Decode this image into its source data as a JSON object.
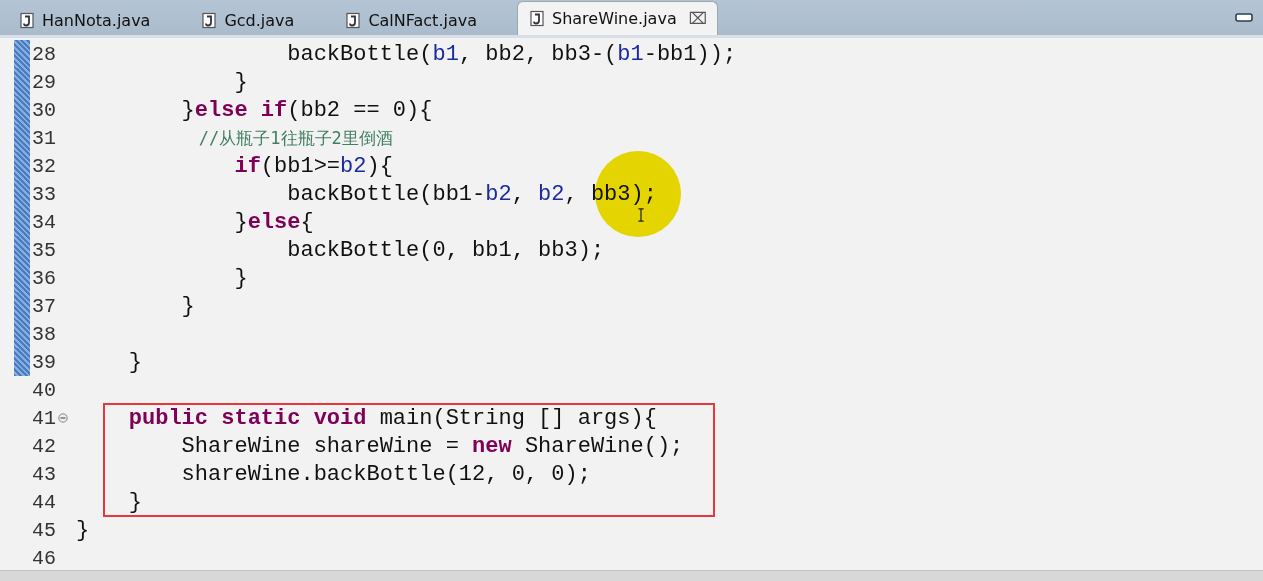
{
  "tabs": [
    {
      "label": "HanNota.java",
      "selected": false
    },
    {
      "label": "Gcd.java",
      "selected": false
    },
    {
      "label": "CalNFact.java",
      "selected": false
    },
    {
      "label": "ShareWine.java",
      "selected": true,
      "close": "⌧"
    }
  ],
  "lines": [
    {
      "number": "28",
      "changed": true,
      "boxed": false,
      "tokens": [
        {
          "kind": "plain",
          "text": "                backBottle("
        },
        {
          "kind": "field",
          "text": "b1"
        },
        {
          "kind": "plain",
          "text": ", bb2, bb3-("
        },
        {
          "kind": "field",
          "text": "b1"
        },
        {
          "kind": "plain",
          "text": "-bb1));"
        }
      ]
    },
    {
      "number": "29",
      "changed": true,
      "boxed": false,
      "tokens": [
        {
          "kind": "plain",
          "text": "            }"
        }
      ]
    },
    {
      "number": "30",
      "changed": true,
      "boxed": false,
      "tokens": [
        {
          "kind": "plain",
          "text": "        }"
        },
        {
          "kind": "keyword",
          "text": "else if"
        },
        {
          "kind": "plain",
          "text": "(bb2 == 0){"
        }
      ]
    },
    {
      "number": "31",
      "changed": true,
      "boxed": false,
      "tokens": [
        {
          "kind": "comment",
          "text": "            //从瓶子1往瓶子2里倒酒"
        }
      ]
    },
    {
      "number": "32",
      "changed": true,
      "boxed": false,
      "tokens": [
        {
          "kind": "keyword",
          "text": "            if"
        },
        {
          "kind": "plain",
          "text": "(bb1>="
        },
        {
          "kind": "field",
          "text": "b2"
        },
        {
          "kind": "plain",
          "text": "){"
        }
      ]
    },
    {
      "number": "33",
      "changed": true,
      "boxed": false,
      "tokens": [
        {
          "kind": "plain",
          "text": "                backBottle(bb1-"
        },
        {
          "kind": "field",
          "text": "b2"
        },
        {
          "kind": "plain",
          "text": ", "
        },
        {
          "kind": "field",
          "text": "b2"
        },
        {
          "kind": "plain",
          "text": ", bb3);"
        }
      ]
    },
    {
      "number": "34",
      "changed": true,
      "boxed": false,
      "tokens": [
        {
          "kind": "plain",
          "text": "            }"
        },
        {
          "kind": "keyword",
          "text": "else"
        },
        {
          "kind": "plain",
          "text": "{"
        }
      ]
    },
    {
      "number": "35",
      "changed": true,
      "boxed": false,
      "tokens": [
        {
          "kind": "plain",
          "text": "                backBottle(0, bb1, bb3);"
        }
      ]
    },
    {
      "number": "36",
      "changed": true,
      "boxed": false,
      "tokens": [
        {
          "kind": "plain",
          "text": "            }"
        }
      ]
    },
    {
      "number": "37",
      "changed": true,
      "boxed": false,
      "tokens": [
        {
          "kind": "plain",
          "text": "        }"
        }
      ]
    },
    {
      "number": "38",
      "changed": true,
      "boxed": false
    },
    {
      "number": "39",
      "changed": true,
      "boxed": false,
      "tokens": [
        {
          "kind": "plain",
          "text": "    }"
        }
      ]
    },
    {
      "number": "40",
      "changed": false,
      "boxed": false
    },
    {
      "number": "41",
      "changed": false,
      "boxed": true,
      "fold_expanded": true,
      "tokens": [
        {
          "kind": "keyword",
          "text": "    public static void"
        },
        {
          "kind": "plain",
          "text": " main(String [] args){"
        }
      ]
    },
    {
      "number": "42",
      "changed": false,
      "boxed": true,
      "tokens": [
        {
          "kind": "plain",
          "text": "        ShareWine shareWine = "
        },
        {
          "kind": "keyword",
          "text": "new"
        },
        {
          "kind": "plain",
          "text": " ShareWine();"
        }
      ]
    },
    {
      "number": "43",
      "changed": false,
      "boxed": true,
      "tokens": [
        {
          "kind": "plain",
          "text": "        shareWine.backBottle(12, 0, 0);"
        }
      ]
    },
    {
      "number": "44",
      "changed": false,
      "boxed": true,
      "tokens": [
        {
          "kind": "plain",
          "text": "    }"
        }
      ]
    },
    {
      "number": "45",
      "changed": false,
      "boxed": false,
      "tokens": [
        {
          "kind": "plain",
          "text": "}"
        }
      ]
    },
    {
      "number": "46",
      "changed": false,
      "boxed": false
    }
  ]
}
